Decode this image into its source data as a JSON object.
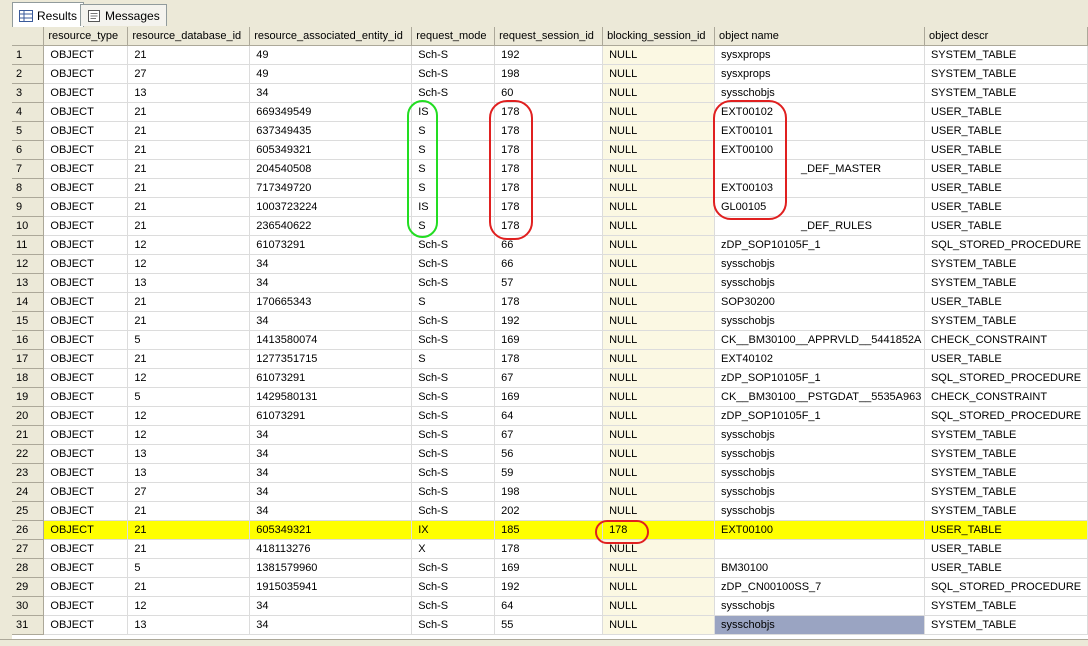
{
  "tabs": [
    {
      "label": "Results",
      "icon": "grid-icon"
    },
    {
      "label": "Messages",
      "icon": "messages-icon"
    }
  ],
  "grid": {
    "columns": [
      "resource_type",
      "resource_database_id",
      "resource_associated_entity_id",
      "request_mode",
      "request_session_id",
      "blocking_session_id",
      "object name",
      "object descr"
    ],
    "rows": [
      [
        "1",
        "OBJECT",
        "21",
        "49",
        "Sch-S",
        "192",
        "NULL",
        "sysxprops",
        "SYSTEM_TABLE"
      ],
      [
        "2",
        "OBJECT",
        "27",
        "49",
        "Sch-S",
        "198",
        "NULL",
        "sysxprops",
        "SYSTEM_TABLE"
      ],
      [
        "3",
        "OBJECT",
        "13",
        "34",
        "Sch-S",
        "60",
        "NULL",
        "sysschobjs",
        "SYSTEM_TABLE"
      ],
      [
        "4",
        "OBJECT",
        "21",
        "669349549",
        "IS",
        "178",
        "NULL",
        "EXT00102",
        "USER_TABLE"
      ],
      [
        "5",
        "OBJECT",
        "21",
        "637349435",
        "S",
        "178",
        "NULL",
        "EXT00101",
        "USER_TABLE"
      ],
      [
        "6",
        "OBJECT",
        "21",
        "605349321",
        "S",
        "178",
        "NULL",
        "EXT00100",
        "USER_TABLE"
      ],
      [
        "7",
        "OBJECT",
        "21",
        "204540508",
        "S",
        "178",
        "NULL",
        "_DEF_MASTER",
        "USER_TABLE"
      ],
      [
        "8",
        "OBJECT",
        "21",
        "717349720",
        "S",
        "178",
        "NULL",
        "EXT00103",
        "USER_TABLE"
      ],
      [
        "9",
        "OBJECT",
        "21",
        "1003723224",
        "IS",
        "178",
        "NULL",
        "GL00105",
        "USER_TABLE"
      ],
      [
        "10",
        "OBJECT",
        "21",
        "236540622",
        "S",
        "178",
        "NULL",
        "_DEF_RULES",
        "USER_TABLE"
      ],
      [
        "11",
        "OBJECT",
        "12",
        "61073291",
        "Sch-S",
        "66",
        "NULL",
        "zDP_SOP10105F_1",
        "SQL_STORED_PROCEDURE"
      ],
      [
        "12",
        "OBJECT",
        "12",
        "34",
        "Sch-S",
        "66",
        "NULL",
        "sysschobjs",
        "SYSTEM_TABLE"
      ],
      [
        "13",
        "OBJECT",
        "13",
        "34",
        "Sch-S",
        "57",
        "NULL",
        "sysschobjs",
        "SYSTEM_TABLE"
      ],
      [
        "14",
        "OBJECT",
        "21",
        "170665343",
        "S",
        "178",
        "NULL",
        "SOP30200",
        "USER_TABLE"
      ],
      [
        "15",
        "OBJECT",
        "21",
        "34",
        "Sch-S",
        "192",
        "NULL",
        "sysschobjs",
        "SYSTEM_TABLE"
      ],
      [
        "16",
        "OBJECT",
        "5",
        "1413580074",
        "Sch-S",
        "169",
        "NULL",
        "CK__BM30100__APPRVLD__5441852A",
        "CHECK_CONSTRAINT"
      ],
      [
        "17",
        "OBJECT",
        "21",
        "1277351715",
        "S",
        "178",
        "NULL",
        "EXT40102",
        "USER_TABLE"
      ],
      [
        "18",
        "OBJECT",
        "12",
        "61073291",
        "Sch-S",
        "67",
        "NULL",
        "zDP_SOP10105F_1",
        "SQL_STORED_PROCEDURE"
      ],
      [
        "19",
        "OBJECT",
        "5",
        "1429580131",
        "Sch-S",
        "169",
        "NULL",
        "CK__BM30100__PSTGDAT__5535A963",
        "CHECK_CONSTRAINT"
      ],
      [
        "20",
        "OBJECT",
        "12",
        "61073291",
        "Sch-S",
        "64",
        "NULL",
        "zDP_SOP10105F_1",
        "SQL_STORED_PROCEDURE"
      ],
      [
        "21",
        "OBJECT",
        "12",
        "34",
        "Sch-S",
        "67",
        "NULL",
        "sysschobjs",
        "SYSTEM_TABLE"
      ],
      [
        "22",
        "OBJECT",
        "13",
        "34",
        "Sch-S",
        "56",
        "NULL",
        "sysschobjs",
        "SYSTEM_TABLE"
      ],
      [
        "23",
        "OBJECT",
        "13",
        "34",
        "Sch-S",
        "59",
        "NULL",
        "sysschobjs",
        "SYSTEM_TABLE"
      ],
      [
        "24",
        "OBJECT",
        "27",
        "34",
        "Sch-S",
        "198",
        "NULL",
        "sysschobjs",
        "SYSTEM_TABLE"
      ],
      [
        "25",
        "OBJECT",
        "21",
        "34",
        "Sch-S",
        "202",
        "NULL",
        "sysschobjs",
        "SYSTEM_TABLE"
      ],
      [
        "26",
        "OBJECT",
        "21",
        "605349321",
        "IX",
        "185",
        "178",
        "EXT00100",
        "USER_TABLE"
      ],
      [
        "27",
        "OBJECT",
        "21",
        "418113276",
        "X",
        "178",
        "NULL",
        "",
        "USER_TABLE"
      ],
      [
        "28",
        "OBJECT",
        "5",
        "1381579960",
        "Sch-S",
        "169",
        "NULL",
        "BM30100",
        "USER_TABLE"
      ],
      [
        "29",
        "OBJECT",
        "21",
        "1915035941",
        "Sch-S",
        "192",
        "NULL",
        "zDP_CN00100SS_7",
        "SQL_STORED_PROCEDURE"
      ],
      [
        "30",
        "OBJECT",
        "12",
        "34",
        "Sch-S",
        "64",
        "NULL",
        "sysschobjs",
        "SYSTEM_TABLE"
      ],
      [
        "31",
        "OBJECT",
        "13",
        "34",
        "Sch-S",
        "55",
        "NULL",
        "sysschobjs",
        "SYSTEM_TABLE"
      ]
    ],
    "highlighted_row": 26,
    "selected_cell": {
      "row": 31,
      "col": 7
    }
  },
  "colors": {
    "highlight": "#ffff00",
    "blocking_column_bg": "#fbf8e3",
    "annotation_red": "#e02020",
    "annotation_green": "#22dd22",
    "selection": "#9aa4c2"
  }
}
